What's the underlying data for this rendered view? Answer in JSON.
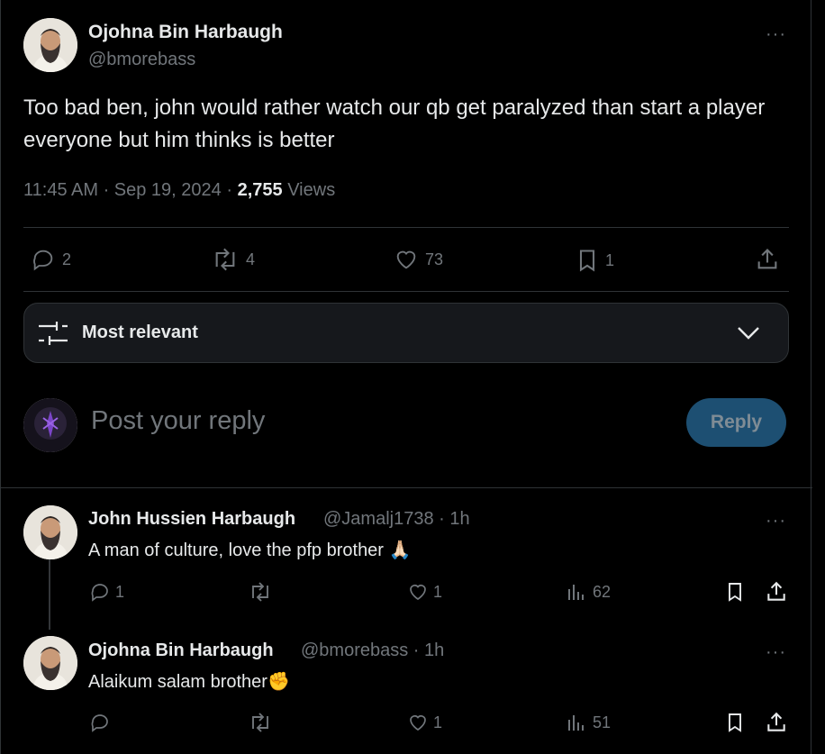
{
  "tweet": {
    "author_name": "Ojohna Bin Harbaugh",
    "author_handle": "@bmorebass",
    "text": "Too bad ben, john would rather watch our qb get paralyzed than start a player everyone but him thinks is better",
    "time": "11:45 AM · Sep 19, 2024 ·",
    "views_count": "2,755",
    "views_label": "Views",
    "more_icon": "···",
    "stats": {
      "replies": "2",
      "reposts": "4",
      "likes": "73",
      "bookmarks": "1"
    }
  },
  "sort": {
    "label": "Most relevant"
  },
  "composer": {
    "placeholder": "Post your reply",
    "button_label": "Reply"
  },
  "replies": [
    {
      "name": "John Hussien Harbaugh",
      "handle_time": "@Jamalj1738 · 1h",
      "text": "A man of culture, love the pfp brother 🙏🏻",
      "replies": "1",
      "reposts": "",
      "likes": "1",
      "views": "62"
    },
    {
      "name": "Ojohna Bin Harbaugh",
      "handle_time": "@bmorebass · 1h",
      "text": "Alaikum salam brother✊",
      "replies": "",
      "reposts": "",
      "likes": "1",
      "views": "51"
    }
  ],
  "colors": {
    "background": "#000000",
    "text": "#e7e9ea",
    "secondary": "#71767b",
    "border": "#2f3336",
    "reply_button": "#1d4f72"
  }
}
